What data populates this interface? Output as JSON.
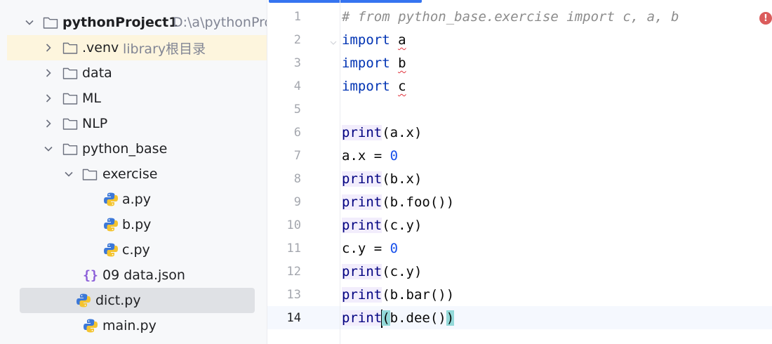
{
  "tree": {
    "items": [
      {
        "label": "pythonProject1",
        "hint": "D:\\a\\pythonPro",
        "kind": "project-root",
        "icon": "folder-icon",
        "expanded": true
      },
      {
        "label": ".venv",
        "hint": "library根目录",
        "kind": "folder",
        "icon": "folder-icon",
        "expanded": false
      },
      {
        "label": "data",
        "kind": "folder",
        "icon": "folder-icon",
        "expanded": false
      },
      {
        "label": "ML",
        "kind": "folder",
        "icon": "folder-icon",
        "expanded": false
      },
      {
        "label": "NLP",
        "kind": "folder",
        "icon": "folder-icon",
        "expanded": false
      },
      {
        "label": "python_base",
        "kind": "folder",
        "icon": "folder-icon",
        "expanded": true
      },
      {
        "label": "exercise",
        "kind": "folder",
        "icon": "folder-icon",
        "expanded": true
      },
      {
        "label": "a.py",
        "kind": "file",
        "icon": "python-file-icon"
      },
      {
        "label": "b.py",
        "kind": "file",
        "icon": "python-file-icon"
      },
      {
        "label": "c.py",
        "kind": "file",
        "icon": "python-file-icon"
      },
      {
        "label": "09 data.json",
        "kind": "file",
        "icon": "json-file-icon",
        "icon_glyph": "{}"
      },
      {
        "label": "dict.py",
        "kind": "file",
        "icon": "python-file-icon",
        "selected": true
      },
      {
        "label": "main.py",
        "kind": "file",
        "icon": "python-file-icon"
      }
    ]
  },
  "editor": {
    "current_line": 14,
    "colors": {
      "keyword": "#0033b3",
      "builtin_call": "#000080",
      "number": "#1750eb",
      "comment": "#8c8c8c",
      "error": "#e0303a"
    },
    "lines": [
      {
        "n": "1",
        "parts": {
          "comment": "# from python_base.exercise import c, a, b"
        }
      },
      {
        "n": "2",
        "parts": {
          "kw": "import",
          "sp": " ",
          "mod": "a"
        }
      },
      {
        "n": "3",
        "parts": {
          "kw": "import",
          "sp": " ",
          "mod": "b"
        }
      },
      {
        "n": "4",
        "parts": {
          "kw": "import",
          "sp": " ",
          "mod": "c"
        }
      },
      {
        "n": "5",
        "parts": {}
      },
      {
        "n": "6",
        "parts": {
          "fn": "print",
          "rest": "(a.x)"
        }
      },
      {
        "n": "7",
        "parts": {
          "lhs": "a.x = ",
          "num": "0"
        }
      },
      {
        "n": "8",
        "parts": {
          "fn": "print",
          "rest": "(b.x)"
        }
      },
      {
        "n": "9",
        "parts": {
          "fn": "print",
          "rest": "(b.foo())"
        }
      },
      {
        "n": "10",
        "parts": {
          "fn": "print",
          "rest": "(c.y)"
        }
      },
      {
        "n": "11",
        "parts": {
          "lhs": "c.y = ",
          "num": "0"
        }
      },
      {
        "n": "12",
        "parts": {
          "fn": "print",
          "rest": "(c.y)"
        }
      },
      {
        "n": "13",
        "parts": {
          "fn": "print",
          "rest": "(b.bar())"
        }
      },
      {
        "n": "14",
        "parts": {
          "fn": "print",
          "open": "(",
          "mid": "b.dee()",
          "close": ")"
        }
      }
    ],
    "error_indicator": "!"
  }
}
